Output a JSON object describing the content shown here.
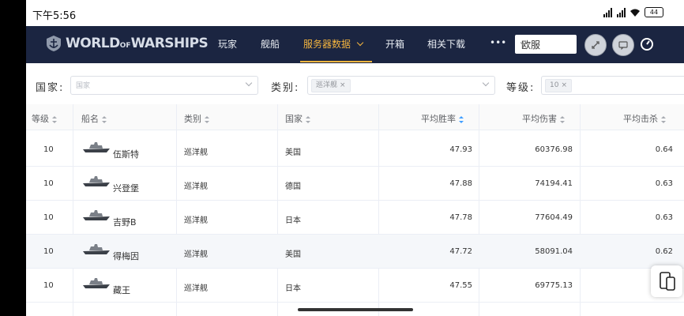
{
  "status": {
    "time": "下午5:56",
    "battery": "44"
  },
  "nav": {
    "logo": {
      "part1": "WORLD",
      "part2": "OF",
      "part3": "WARSHIPS"
    },
    "items": [
      "玩家",
      "舰船",
      "服务器数据",
      "开箱",
      "相关下载",
      "•••"
    ],
    "active_item": "服务器数据",
    "server": "欧服",
    "accent": "#f5b53f"
  },
  "filters": {
    "country_label": "国家:",
    "country_placeholder": "国家",
    "type_label": "类别:",
    "type_tag": "巡洋舰",
    "level_label": "等级:",
    "level_tag": "10"
  },
  "table": {
    "headers": [
      "等级",
      "船名",
      "类别",
      "国家",
      "平均胜率",
      "平均伤害",
      "平均击杀"
    ],
    "rows": [
      {
        "level": "10",
        "name": "伍斯特",
        "type": "巡洋舰",
        "country": "美国",
        "winrate": "47.93",
        "damage": "60376.98",
        "kills": "0.64"
      },
      {
        "level": "10",
        "name": "兴登堡",
        "type": "巡洋舰",
        "country": "德国",
        "winrate": "47.88",
        "damage": "74194.41",
        "kills": "0.63"
      },
      {
        "level": "10",
        "name": "吉野B",
        "type": "巡洋舰",
        "country": "日本",
        "winrate": "47.78",
        "damage": "77604.49",
        "kills": "0.63"
      },
      {
        "level": "10",
        "name": "得梅因",
        "type": "巡洋舰",
        "country": "美国",
        "winrate": "47.72",
        "damage": "58091.04",
        "kills": "0.62"
      },
      {
        "level": "10",
        "name": "藏王",
        "type": "巡洋舰",
        "country": "日本",
        "winrate": "47.55",
        "damage": "69775.13",
        "kills": ""
      }
    ]
  }
}
